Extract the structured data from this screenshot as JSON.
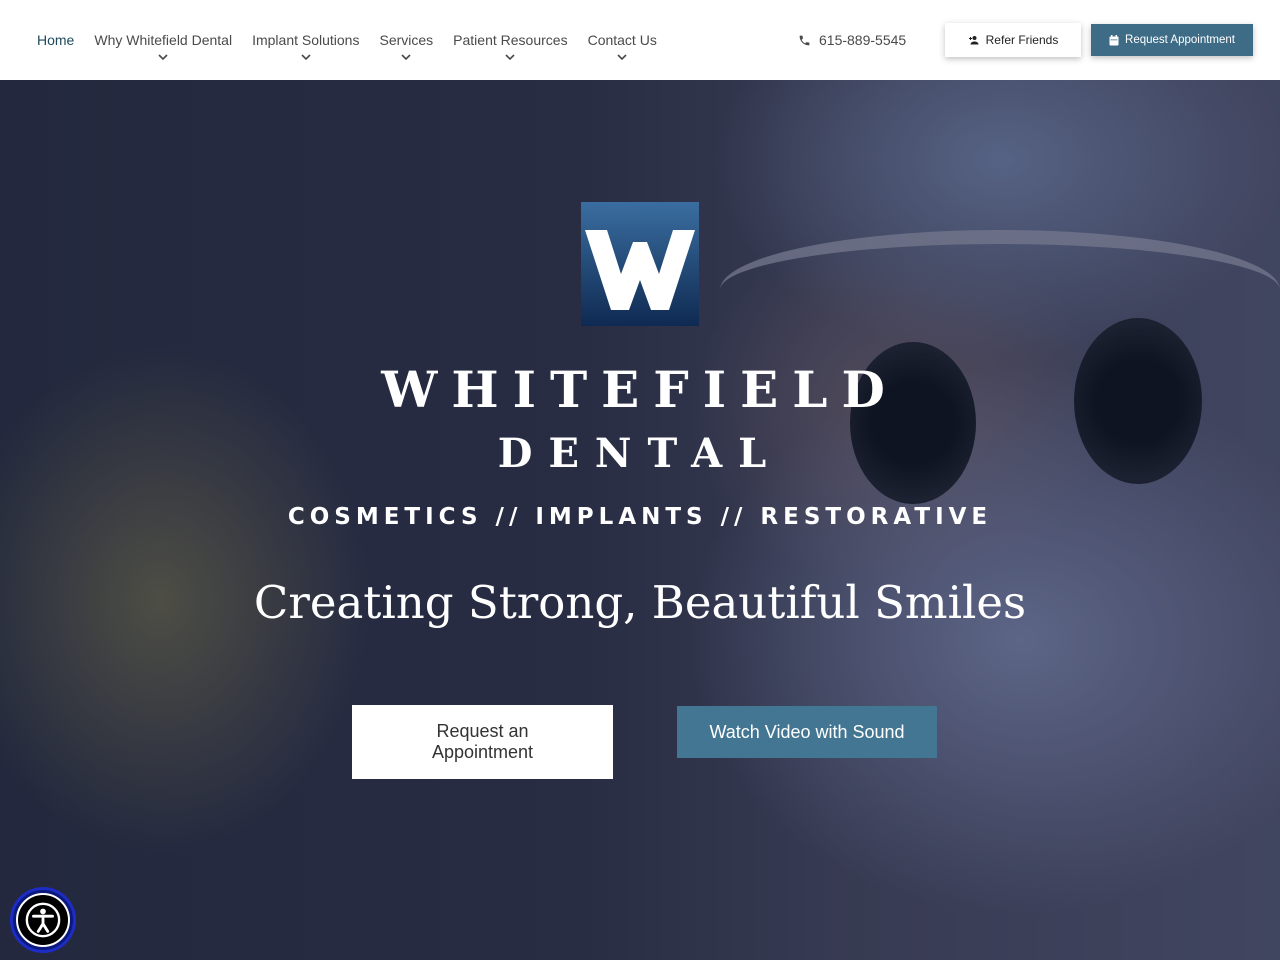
{
  "nav": {
    "items": [
      {
        "label": "Home",
        "active": true,
        "has_dropdown": false
      },
      {
        "label": "Why Whitefield Dental",
        "active": false,
        "has_dropdown": true
      },
      {
        "label": "Implant Solutions",
        "active": false,
        "has_dropdown": true
      },
      {
        "label": "Services",
        "active": false,
        "has_dropdown": true
      },
      {
        "label": "Patient Resources",
        "active": false,
        "has_dropdown": true
      },
      {
        "label": "Contact Us",
        "active": false,
        "has_dropdown": true
      }
    ]
  },
  "header": {
    "phone": "615-889-5545",
    "refer_label": "Refer Friends",
    "request_label": "Request Appointment"
  },
  "hero": {
    "logo_letter": "W",
    "brand_line1": "WHITEFIELD",
    "brand_line2": "DENTAL",
    "tagline": "COSMETICS // IMPLANTS // RESTORATIVE",
    "headline": "Creating Strong, Beautiful Smiles",
    "cta_request": "Request an Appointment",
    "cta_video": "Watch Video with Sound"
  },
  "colors": {
    "accent": "#3e6b85",
    "nav_active": "#1f4a5e",
    "logo_top": "#3a6ea0",
    "logo_bottom": "#0f2a52",
    "a11y_bg": "#0b1a7a"
  },
  "icons": {
    "phone": "phone-icon",
    "refer": "user-plus-icon",
    "request": "calendar-icon",
    "accessibility": "accessibility-icon"
  }
}
